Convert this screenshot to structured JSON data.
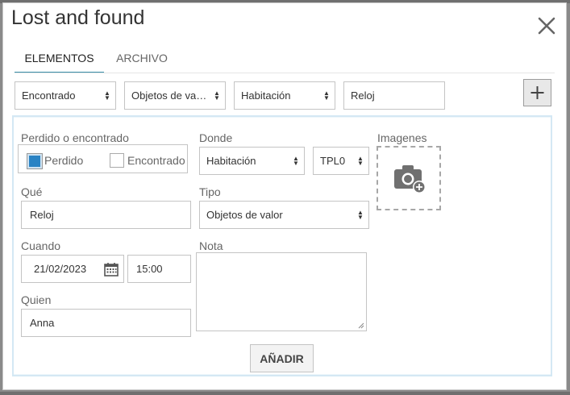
{
  "modal": {
    "title": "Lost and found",
    "tabs": [
      {
        "label": "ELEMENTOS",
        "active": true
      },
      {
        "label": "ARCHIVO",
        "active": false
      }
    ]
  },
  "filters": {
    "status_select": "Encontrado",
    "category_select": "Objetos de va…",
    "location_select": "Habitación",
    "search_value": "Reloj"
  },
  "form": {
    "lost_found_label": "Perdido o encontrado",
    "lost_option": "Perdido",
    "found_option": "Encontrado",
    "lost_checked": true,
    "found_checked": false,
    "where_label": "Donde",
    "where_value": "Habitación",
    "room_value": "TPL0",
    "images_label": "Imagenes",
    "what_label": "Qué",
    "what_value": "Reloj",
    "type_label": "Tipo",
    "type_value": "Objetos de valor",
    "when_label": "Cuando",
    "date_value": "21/02/2023",
    "time_value": "15:00",
    "note_label": "Nota",
    "note_value": "",
    "who_label": "Quien",
    "who_value": "Anna",
    "submit_label": "AÑADIR"
  },
  "icons": {
    "close": "close-icon",
    "add": "plus-icon",
    "calendar": "calendar-icon",
    "camera": "camera-add-icon",
    "caret": "sort-caret-icon"
  },
  "colors": {
    "accent": "#2a83c4",
    "tab_underline": "#3a8fa8",
    "panel_bg": "#eef6fb"
  }
}
